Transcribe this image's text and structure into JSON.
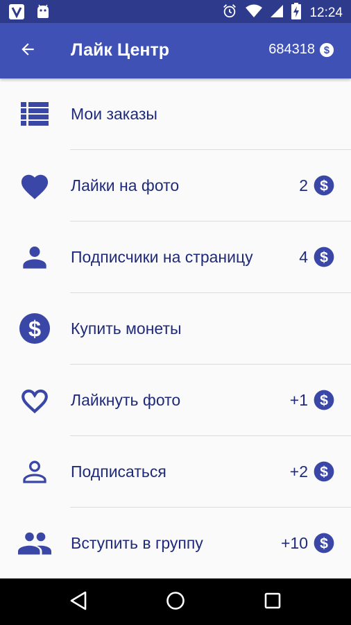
{
  "status_bar": {
    "time": "12:24",
    "icons": [
      "vpn-app-icon",
      "android-icon",
      "alarm-icon",
      "wifi-icon",
      "signal-icon",
      "battery-charging-icon"
    ]
  },
  "toolbar": {
    "title": "Лайк Центр",
    "balance": "684318",
    "back_icon": "arrow-back-icon",
    "coin_icon": "coin-icon"
  },
  "menu": {
    "items": [
      {
        "label": "Мои заказы",
        "icon": "list-icon",
        "cost": ""
      },
      {
        "label": "Лайки на фото",
        "icon": "heart-filled-icon",
        "cost": "2"
      },
      {
        "label": "Подписчики на страницу",
        "icon": "person-filled-icon",
        "cost": "4"
      },
      {
        "label": "Купить монеты",
        "icon": "coin-large-icon",
        "cost": ""
      },
      {
        "label": "Лайкнуть фото",
        "icon": "heart-outline-icon",
        "cost": "+1"
      },
      {
        "label": "Подписаться",
        "icon": "person-outline-icon",
        "cost": "+2"
      },
      {
        "label": "Вступить в группу",
        "icon": "group-icon",
        "cost": "+10"
      }
    ]
  },
  "nav_bar": {
    "icons": [
      "back-triangle-icon",
      "home-circle-icon",
      "recents-square-icon"
    ]
  },
  "colors": {
    "primary": "#3f51b5",
    "status_bar": "#2e3a8c",
    "text": "#1f2a7a",
    "icon": "#3a47a6",
    "background": "#fafafa"
  }
}
